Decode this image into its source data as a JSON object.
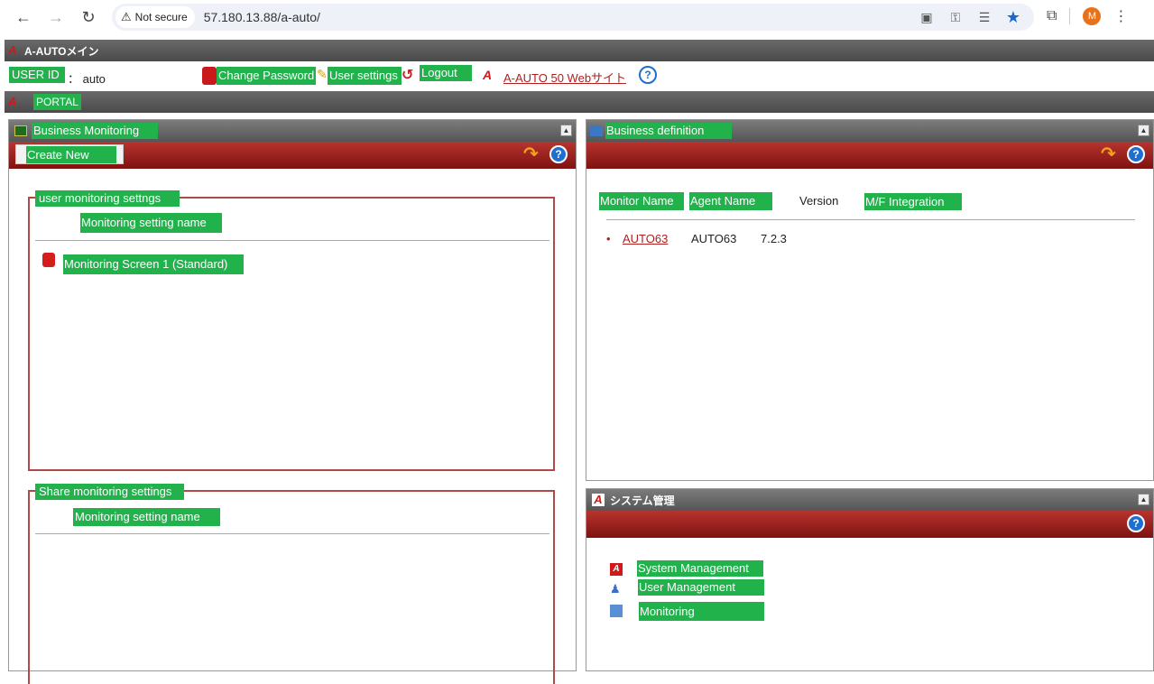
{
  "browser": {
    "security_label": "Not secure",
    "url": "57.180.13.88/a-auto/",
    "avatar_letter": "M"
  },
  "titlebar": {
    "title": "A-AUTOメイン"
  },
  "userbar": {
    "user_id_label": "USER ID",
    "user_id_value": "： auto",
    "change_password": "Change Password",
    "user_settings": "User settings",
    "logout": "Logout",
    "website_link": "A-AUTO 50 Webサイト"
  },
  "portal": {
    "label": "PORTAL"
  },
  "business_monitoring": {
    "title": "Business Monitoring",
    "create_new": "Create New",
    "user_section": {
      "legend": "user monitoring settngs",
      "column": "Monitoring setting name",
      "items": [
        "Monitoring Screen 1 (Standard)"
      ]
    },
    "share_section": {
      "legend": "Share monitoring settings",
      "column": "Monitoring setting name"
    }
  },
  "business_definition": {
    "title": "Business definition",
    "columns": [
      "Monitor Name",
      "Agent Name",
      "Version",
      "M/F Integration"
    ],
    "rows": [
      {
        "monitor": "AUTO63",
        "agent": "AUTO63",
        "version": "7.2.3"
      }
    ]
  },
  "system_admin": {
    "title": "システム管理",
    "items": [
      "System Management",
      "User Management",
      "Monitoring"
    ]
  },
  "colors": {
    "accent_red": "#9e1f1c",
    "green_label": "#22b24c",
    "header_gray": "#5a5a5a"
  }
}
